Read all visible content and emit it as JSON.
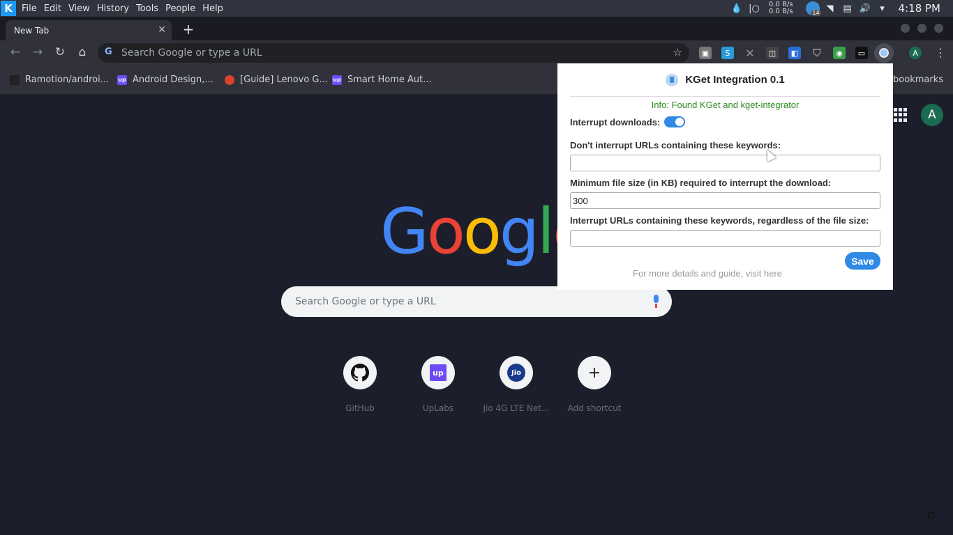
{
  "kde": {
    "logo": "K",
    "menu": [
      "File",
      "Edit",
      "View",
      "History",
      "Tools",
      "People",
      "Help"
    ],
    "net_up": "0.0 B/s",
    "net_down": "0.0 B/s",
    "badge_count": "14",
    "clock": "4:18 PM"
  },
  "tab": {
    "title": "New Tab"
  },
  "omnibox": {
    "placeholder": "Search Google or type a URL"
  },
  "bookmarks": {
    "items": [
      "Ramotion/androi...",
      "Android Design,...",
      "[Guide] Lenovo G...",
      "Smart Home Aut..."
    ],
    "other": "bookmarks"
  },
  "profile": {
    "initial": "A"
  },
  "ntp": {
    "logo": "Google",
    "search_placeholder": "Search Google or type a URL",
    "shortcuts": [
      {
        "label": "GitHub",
        "icon": "github-icon"
      },
      {
        "label": "UpLabs",
        "icon": "uplabs-icon",
        "glyph": "up"
      },
      {
        "label": "Jio 4G LTE Net...",
        "icon": "jio-icon",
        "glyph": "Jio"
      },
      {
        "label": "Add shortcut",
        "icon": "plus-icon",
        "glyph": "+"
      }
    ]
  },
  "popup": {
    "title": "KGet Integration 0.1",
    "info": "Info: Found KGet and kget-integrator",
    "interrupt_label": "Interrupt downloads:",
    "interrupt_enabled": true,
    "exclude_label": "Don't interrupt URLs containing these keywords:",
    "exclude_value": "",
    "min_size_label": "Minimum file size (in KB) required to interrupt the download:",
    "min_size_value": "300",
    "force_label": "Interrupt URLs containing these keywords, regardless of the file size:",
    "force_value": "",
    "save_label": "Save",
    "more_text": "For more details and guide, visit here"
  },
  "colors": {
    "accent": "#2f8ae6",
    "info_green": "#2e8b20",
    "background": "#1c1e2b"
  }
}
